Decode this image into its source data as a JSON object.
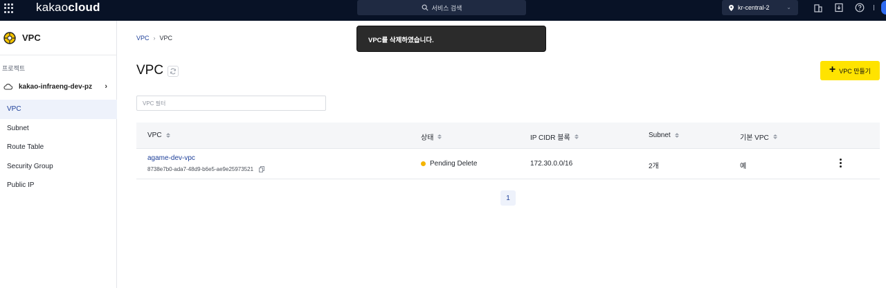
{
  "header": {
    "logo_light": "kakao",
    "logo_bold": "cloud",
    "search_label": "서비스 검색",
    "region": "kr-central-2"
  },
  "sidebar": {
    "service_title": "VPC",
    "project_label": "프로젝트",
    "project_name": "kakao-infraeng-dev-pz",
    "items": [
      {
        "label": "VPC",
        "active": true
      },
      {
        "label": "Subnet"
      },
      {
        "label": "Route Table"
      },
      {
        "label": "Security Group"
      },
      {
        "label": "Public IP"
      }
    ]
  },
  "breadcrumb": [
    "VPC",
    "VPC"
  ],
  "toast": "VPC를 삭제하였습니다.",
  "page": {
    "title": "VPC",
    "create_button": "VPC 만들기",
    "filter_placeholder": "VPC 필터"
  },
  "table": {
    "columns": [
      "VPC",
      "상태",
      "IP CIDR 블록",
      "Subnet",
      "기본 VPC"
    ],
    "rows": [
      {
        "name": "agame-dev-vpc",
        "id": "8738e7b0-ada7-48d9-b6e5-ae9e25973521",
        "status": "Pending Delete",
        "status_color": "#f4b400",
        "cidr": "172.30.0.0/16",
        "subnet": "2개",
        "default": "예"
      }
    ]
  },
  "pagination": {
    "current": "1"
  },
  "colors": {
    "topbar": "#081226",
    "accent": "#ffe300",
    "link": "#1d3f99"
  }
}
